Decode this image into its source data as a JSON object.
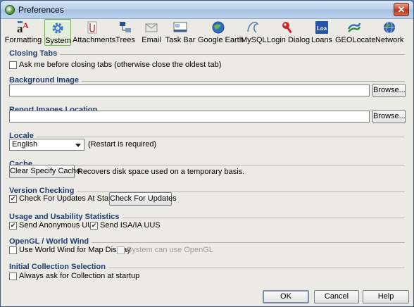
{
  "window": {
    "title": "Preferences",
    "close_glyph": "✕"
  },
  "toolbar": {
    "items": [
      {
        "label": "Formatting",
        "icon": "formatting-icon"
      },
      {
        "label": "System",
        "icon": "gear-icon",
        "selected": true
      },
      {
        "label": "Attachments",
        "icon": "attachment-icon"
      },
      {
        "label": "Trees",
        "icon": "tree-icon"
      },
      {
        "label": "Email",
        "icon": "envelope-icon"
      },
      {
        "label": "Task Bar",
        "icon": "taskbar-icon"
      },
      {
        "label": "Google Earth",
        "icon": "globe-icon"
      },
      {
        "label": "MySQL",
        "icon": "mysql-dolphin-icon"
      },
      {
        "label": "Login Dialog",
        "icon": "key-icon"
      },
      {
        "label": "Loans",
        "icon": "loans-icon",
        "icon_text": "Loa"
      },
      {
        "label": "GEOLocate",
        "icon": "geolocate-icon"
      },
      {
        "label": "Network",
        "icon": "network-globe-icon"
      }
    ]
  },
  "closing_tabs": {
    "title": "Closing Tabs",
    "ask_before_closing": {
      "label": "Ask me before closing tabs (otherwise close the oldest tab)",
      "checked": false
    }
  },
  "background_image": {
    "title": "Background Image",
    "value": "",
    "browse_label": "Browse..."
  },
  "report_images": {
    "title": "Report Images Location",
    "value": "",
    "browse_label": "Browse..."
  },
  "locale": {
    "title": "Locale",
    "selected": "English",
    "note": "(Restart is required)"
  },
  "cache": {
    "title": "Cache",
    "clear_label": "Clear Specify Cache",
    "description": "Recovers disk space used on a temporary basis."
  },
  "version_checking": {
    "title": "Version Checking",
    "check_at_startup": {
      "label": "Check For Updates At Startup",
      "checked": true
    },
    "check_button_label": "Check For Updates"
  },
  "usage_stats": {
    "title": "Usage and Usability Statistics",
    "send_anonymous": {
      "label": "Send Anonymous UUS",
      "checked": true
    },
    "send_isa": {
      "label": "Send ISA/IA UUS",
      "checked": true
    }
  },
  "opengl": {
    "title": "OpenGL / World Wind",
    "use_world_wind": {
      "label": "Use World Wind for Map Display",
      "checked": false
    },
    "system_opengl": {
      "label": "System can use OpenGL",
      "checked": false,
      "disabled": true
    }
  },
  "initial_collection": {
    "title": "Initial Collection Selection",
    "always_ask": {
      "label": "Always ask for Collection at startup",
      "checked": false
    }
  },
  "footer": {
    "ok_label": "OK",
    "cancel_label": "Cancel",
    "help_label": "Help"
  },
  "colors": {
    "section_title": "#1f3d73",
    "selected_tab_border": "#72b653",
    "background": "#eceae4"
  }
}
